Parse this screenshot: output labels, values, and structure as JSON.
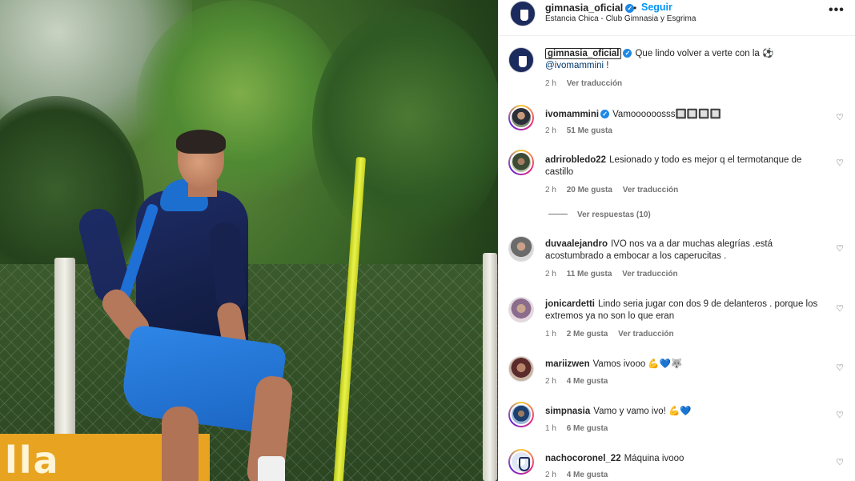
{
  "post": {
    "account": "gimnasia_oficial",
    "follow_label": "Seguir",
    "separator": "•",
    "location": "Estancia Chica - Club Gimnasia y Esgrima",
    "more_icon": "more-horizontal-icon",
    "photo_banner_text": "lla"
  },
  "caption": {
    "user": "gimnasia_oficial",
    "text": "Que lindo volver a verte con la ⚽",
    "mention": "@ivomammini",
    "suffix": " !",
    "time": "2 h",
    "translate": "Ver traducción"
  },
  "comments": [
    {
      "user": "ivomammini",
      "verified": true,
      "text": "Vamoooooosss🔲🔲🔲🔲",
      "time": "2 h",
      "likes": "51 Me gusta",
      "translate": ""
    },
    {
      "user": "adrirobledo22",
      "verified": false,
      "text": "Lesionado y todo es mejor q el termotanque de castillo",
      "time": "2 h",
      "likes": "20 Me gusta",
      "translate": "Ver traducción",
      "replies": "Ver respuestas (10)"
    },
    {
      "user": "duvaalejandro",
      "verified": false,
      "text": "IVO nos va a dar muchas alegrías .está acostumbrado a embocar a los caperucitas .",
      "time": "2 h",
      "likes": "11 Me gusta",
      "translate": "Ver traducción"
    },
    {
      "user": "jonicardetti",
      "verified": false,
      "text": "Lindo seria jugar con dos 9 de delanteros . porque los extremos ya no son lo que eran",
      "time": "1 h",
      "likes": "2 Me gusta",
      "translate": "Ver traducción"
    },
    {
      "user": "mariizwen",
      "verified": false,
      "text": "Vamos ivooo 💪💙🐺",
      "time": "2 h",
      "likes": "4 Me gusta",
      "translate": ""
    },
    {
      "user": "simpnasia",
      "verified": false,
      "text": "Vamo y vamo ivo! 💪💙",
      "time": "1 h",
      "likes": "6 Me gusta",
      "translate": ""
    },
    {
      "user": "nachocoronel_22",
      "verified": false,
      "text": "Máquina ivooo",
      "time": "2 h",
      "likes": "4 Me gusta",
      "translate": ""
    }
  ],
  "icons": {
    "heart": "heart-outline-icon",
    "verified": "verified-badge-icon"
  },
  "colors": {
    "link": "#0095f6",
    "mention": "#00376b",
    "verified": "#1e88e5",
    "meta": "#737373"
  }
}
